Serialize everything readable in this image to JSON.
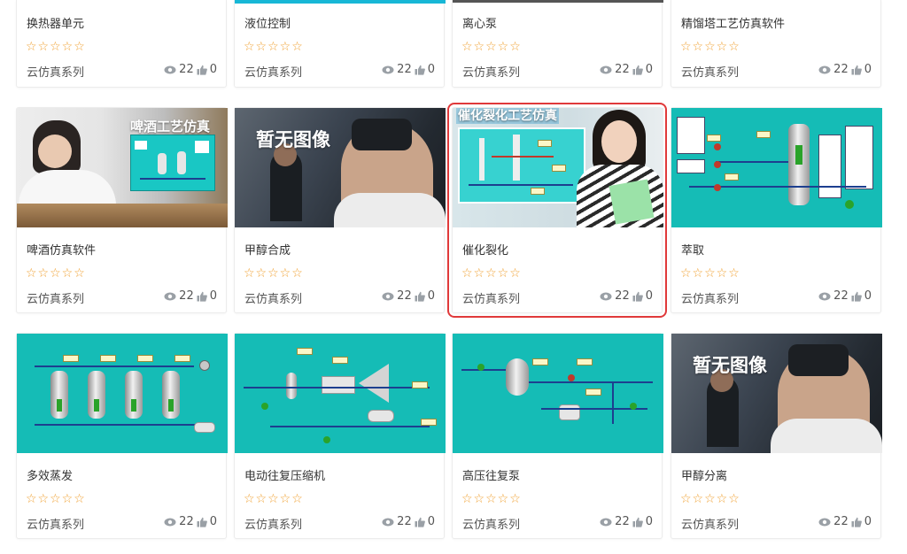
{
  "cards": [
    {
      "title": "换热器单元",
      "series": "云仿真系列",
      "views": "22",
      "likes": "0",
      "rating": "☆☆☆☆☆"
    },
    {
      "title": "液位控制",
      "series": "云仿真系列",
      "views": "22",
      "likes": "0",
      "rating": "☆☆☆☆☆"
    },
    {
      "title": "离心泵",
      "series": "云仿真系列",
      "views": "22",
      "likes": "0",
      "rating": "☆☆☆☆☆"
    },
    {
      "title": "精馏塔工艺仿真软件",
      "series": "云仿真系列",
      "views": "22",
      "likes": "0",
      "rating": "☆☆☆☆☆"
    },
    {
      "title": "啤酒仿真软件",
      "series": "云仿真系列",
      "views": "22",
      "likes": "0",
      "rating": "☆☆☆☆☆",
      "image_text": "啤酒工艺仿真"
    },
    {
      "title": "甲醇合成",
      "series": "云仿真系列",
      "views": "22",
      "likes": "0",
      "rating": "☆☆☆☆☆",
      "image_text": "暂无图像"
    },
    {
      "title": "催化裂化",
      "series": "云仿真系列",
      "views": "22",
      "likes": "0",
      "rating": "☆☆☆☆☆",
      "image_text": "催化裂化工艺仿真",
      "selected": true
    },
    {
      "title": "萃取",
      "series": "云仿真系列",
      "views": "22",
      "likes": "0",
      "rating": "☆☆☆☆☆"
    },
    {
      "title": "多效蒸发",
      "series": "云仿真系列",
      "views": "22",
      "likes": "0",
      "rating": "☆☆☆☆☆"
    },
    {
      "title": "电动往复压缩机",
      "series": "云仿真系列",
      "views": "22",
      "likes": "0",
      "rating": "☆☆☆☆☆"
    },
    {
      "title": "高压往复泵",
      "series": "云仿真系列",
      "views": "22",
      "likes": "0",
      "rating": "☆☆☆☆☆"
    },
    {
      "title": "甲醇分离",
      "series": "云仿真系列",
      "views": "22",
      "likes": "0",
      "rating": "☆☆☆☆☆",
      "image_text": "暂无图像"
    }
  ],
  "colors": {
    "star": "#f0a030",
    "selection_border": "#e0393a",
    "dcs_background": "#15bcb6"
  },
  "icons": {
    "views": "eye-icon",
    "likes": "thumbs-up-icon",
    "rating": "star-icon"
  }
}
